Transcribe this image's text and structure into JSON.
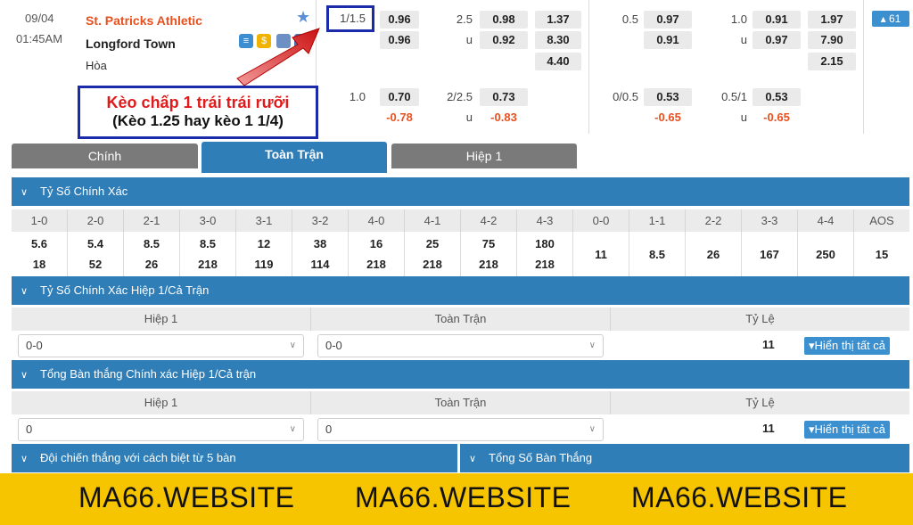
{
  "match": {
    "date": "09/04",
    "time": "01:45AM",
    "home": "St. Patricks Athletic",
    "away": "Longford Town",
    "draw": "Hòa",
    "more_count": "▴ 61"
  },
  "odds": {
    "ft_hdp_line": "1/1.5",
    "ft_hdp_home": "0.96",
    "ft_hdp_away": "0.96",
    "ft_ou_line": "2.5",
    "ft_ou_u": "u",
    "ft_ou_over": "0.98",
    "ft_ou_under": "0.92",
    "ft_1x2_home": "1.37",
    "ft_1x2_away": "8.30",
    "ft_1x2_draw": "4.40",
    "h1_hdp_line": "0.5",
    "h1_hdp_home": "0.97",
    "h1_hdp_away": "0.91",
    "h1_ou_line": "1.0",
    "h1_ou_u": "u",
    "h1_ou_over": "0.91",
    "h1_ou_under": "0.97",
    "h1_1x2_home": "1.97",
    "h1_1x2_away": "7.90",
    "h1_1x2_draw": "2.15",
    "alt_ft_hdp_line": "1.0",
    "alt_ft_hdp_home": "0.70",
    "alt_ft_hdp_away": "-0.78",
    "alt_ft_ou_line": "2/2.5",
    "alt_ft_ou_u": "u",
    "alt_ft_ou_over": "0.73",
    "alt_ft_ou_under": "-0.83",
    "alt_h1_hdp_line": "0/0.5",
    "alt_h1_hdp_home": "0.53",
    "alt_h1_hdp_away": "-0.65",
    "alt_h1_ou_line": "0.5/1",
    "alt_h1_ou_u": "u",
    "alt_h1_ou_over": "0.53",
    "alt_h1_ou_under": "-0.65"
  },
  "annotation": {
    "line1": "Kèo chấp 1 trái trái rưỡi",
    "line2": "(Kèo 1.25 hay kèo 1 1/4)",
    "accent": "#e01a1a",
    "box_color": "#1b2aa8"
  },
  "tabs": [
    "Chính",
    "Toàn Trận",
    "Hiệp 1"
  ],
  "sections": {
    "correct_score": "Tỷ Số Chính Xác",
    "ht_ft_score": "Tỷ Số Chính Xác Hiệp 1/Cả Trận",
    "ht_ft_goals": "Tổng Bàn thắng Chính xác Hiệp 1/Cả trận",
    "win_margin": "Đội chiến thắng với cách biệt từ 5 bàn",
    "total_goals": "Tổng Số Bàn Thắng"
  },
  "correct_score": {
    "headers": [
      "1-0",
      "2-0",
      "2-1",
      "3-0",
      "3-1",
      "3-2",
      "4-0",
      "4-1",
      "4-2",
      "4-3",
      "0-0",
      "1-1",
      "2-2",
      "3-3",
      "4-4",
      "AOS"
    ],
    "top": [
      "5.6",
      "5.4",
      "8.5",
      "8.5",
      "12",
      "38",
      "16",
      "25",
      "75",
      "180",
      "11",
      "8.5",
      "26",
      "167",
      "250",
      "15"
    ],
    "bottom": [
      "18",
      "52",
      "26",
      "218",
      "119",
      "114",
      "218",
      "218",
      "218",
      "218",
      "",
      "",
      "",
      "",
      "",
      ""
    ]
  },
  "ht_ft": {
    "headers": [
      "Hiệp 1",
      "Toàn Trận",
      "Tỷ Lệ"
    ],
    "sel1": "0-0",
    "sel2": "0-0",
    "rate": "11",
    "show_all": "▾Hiển thị tất cả"
  },
  "ht_ft_goals": {
    "headers": [
      "Hiệp 1",
      "Toàn Trận",
      "Tỷ Lệ"
    ],
    "sel1": "0",
    "sel2": "0",
    "rate": "11",
    "show_all": "▾Hiển thị tất cả"
  },
  "banner": [
    "MA66.WEBSITE",
    "MA66.WEBSITE",
    "MA66.WEBSITE"
  ],
  "colors": {
    "primary": "#2f7eb8",
    "tab_inactive": "#777777",
    "home_team": "#e8501e",
    "banner": "#f7c500"
  }
}
